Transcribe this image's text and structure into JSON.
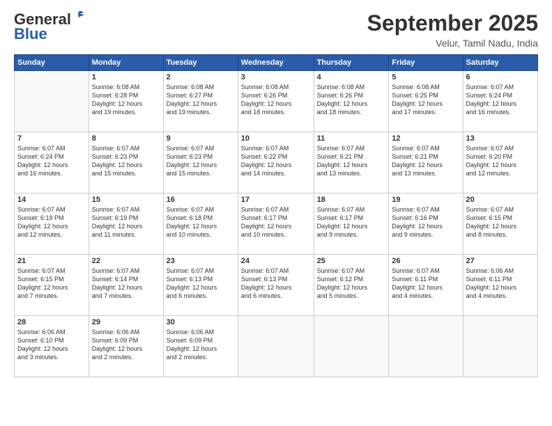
{
  "header": {
    "logo_general": "General",
    "logo_blue": "Blue",
    "month_title": "September 2025",
    "location": "Velur, Tamil Nadu, India"
  },
  "days_of_week": [
    "Sunday",
    "Monday",
    "Tuesday",
    "Wednesday",
    "Thursday",
    "Friday",
    "Saturday"
  ],
  "weeks": [
    [
      {
        "day": "",
        "info": ""
      },
      {
        "day": "1",
        "info": "Sunrise: 6:08 AM\nSunset: 6:28 PM\nDaylight: 12 hours\nand 19 minutes."
      },
      {
        "day": "2",
        "info": "Sunrise: 6:08 AM\nSunset: 6:27 PM\nDaylight: 12 hours\nand 19 minutes."
      },
      {
        "day": "3",
        "info": "Sunrise: 6:08 AM\nSunset: 6:26 PM\nDaylight: 12 hours\nand 18 minutes."
      },
      {
        "day": "4",
        "info": "Sunrise: 6:08 AM\nSunset: 6:26 PM\nDaylight: 12 hours\nand 18 minutes."
      },
      {
        "day": "5",
        "info": "Sunrise: 6:08 AM\nSunset: 6:25 PM\nDaylight: 12 hours\nand 17 minutes."
      },
      {
        "day": "6",
        "info": "Sunrise: 6:07 AM\nSunset: 6:24 PM\nDaylight: 12 hours\nand 16 minutes."
      }
    ],
    [
      {
        "day": "7",
        "info": "Sunrise: 6:07 AM\nSunset: 6:24 PM\nDaylight: 12 hours\nand 16 minutes."
      },
      {
        "day": "8",
        "info": "Sunrise: 6:07 AM\nSunset: 6:23 PM\nDaylight: 12 hours\nand 15 minutes."
      },
      {
        "day": "9",
        "info": "Sunrise: 6:07 AM\nSunset: 6:23 PM\nDaylight: 12 hours\nand 15 minutes."
      },
      {
        "day": "10",
        "info": "Sunrise: 6:07 AM\nSunset: 6:22 PM\nDaylight: 12 hours\nand 14 minutes."
      },
      {
        "day": "11",
        "info": "Sunrise: 6:07 AM\nSunset: 6:21 PM\nDaylight: 12 hours\nand 13 minutes."
      },
      {
        "day": "12",
        "info": "Sunrise: 6:07 AM\nSunset: 6:21 PM\nDaylight: 12 hours\nand 13 minutes."
      },
      {
        "day": "13",
        "info": "Sunrise: 6:07 AM\nSunset: 6:20 PM\nDaylight: 12 hours\nand 12 minutes."
      }
    ],
    [
      {
        "day": "14",
        "info": "Sunrise: 6:07 AM\nSunset: 6:19 PM\nDaylight: 12 hours\nand 12 minutes."
      },
      {
        "day": "15",
        "info": "Sunrise: 6:07 AM\nSunset: 6:19 PM\nDaylight: 12 hours\nand 11 minutes."
      },
      {
        "day": "16",
        "info": "Sunrise: 6:07 AM\nSunset: 6:18 PM\nDaylight: 12 hours\nand 10 minutes."
      },
      {
        "day": "17",
        "info": "Sunrise: 6:07 AM\nSunset: 6:17 PM\nDaylight: 12 hours\nand 10 minutes."
      },
      {
        "day": "18",
        "info": "Sunrise: 6:07 AM\nSunset: 6:17 PM\nDaylight: 12 hours\nand 9 minutes."
      },
      {
        "day": "19",
        "info": "Sunrise: 6:07 AM\nSunset: 6:16 PM\nDaylight: 12 hours\nand 9 minutes."
      },
      {
        "day": "20",
        "info": "Sunrise: 6:07 AM\nSunset: 6:15 PM\nDaylight: 12 hours\nand 8 minutes."
      }
    ],
    [
      {
        "day": "21",
        "info": "Sunrise: 6:07 AM\nSunset: 6:15 PM\nDaylight: 12 hours\nand 7 minutes."
      },
      {
        "day": "22",
        "info": "Sunrise: 6:07 AM\nSunset: 6:14 PM\nDaylight: 12 hours\nand 7 minutes."
      },
      {
        "day": "23",
        "info": "Sunrise: 6:07 AM\nSunset: 6:13 PM\nDaylight: 12 hours\nand 6 minutes."
      },
      {
        "day": "24",
        "info": "Sunrise: 6:07 AM\nSunset: 6:13 PM\nDaylight: 12 hours\nand 6 minutes."
      },
      {
        "day": "25",
        "info": "Sunrise: 6:07 AM\nSunset: 6:12 PM\nDaylight: 12 hours\nand 5 minutes."
      },
      {
        "day": "26",
        "info": "Sunrise: 6:07 AM\nSunset: 6:11 PM\nDaylight: 12 hours\nand 4 minutes."
      },
      {
        "day": "27",
        "info": "Sunrise: 6:06 AM\nSunset: 6:11 PM\nDaylight: 12 hours\nand 4 minutes."
      }
    ],
    [
      {
        "day": "28",
        "info": "Sunrise: 6:06 AM\nSunset: 6:10 PM\nDaylight: 12 hours\nand 3 minutes."
      },
      {
        "day": "29",
        "info": "Sunrise: 6:06 AM\nSunset: 6:09 PM\nDaylight: 12 hours\nand 2 minutes."
      },
      {
        "day": "30",
        "info": "Sunrise: 6:06 AM\nSunset: 6:09 PM\nDaylight: 12 hours\nand 2 minutes."
      },
      {
        "day": "",
        "info": ""
      },
      {
        "day": "",
        "info": ""
      },
      {
        "day": "",
        "info": ""
      },
      {
        "day": "",
        "info": ""
      }
    ]
  ]
}
